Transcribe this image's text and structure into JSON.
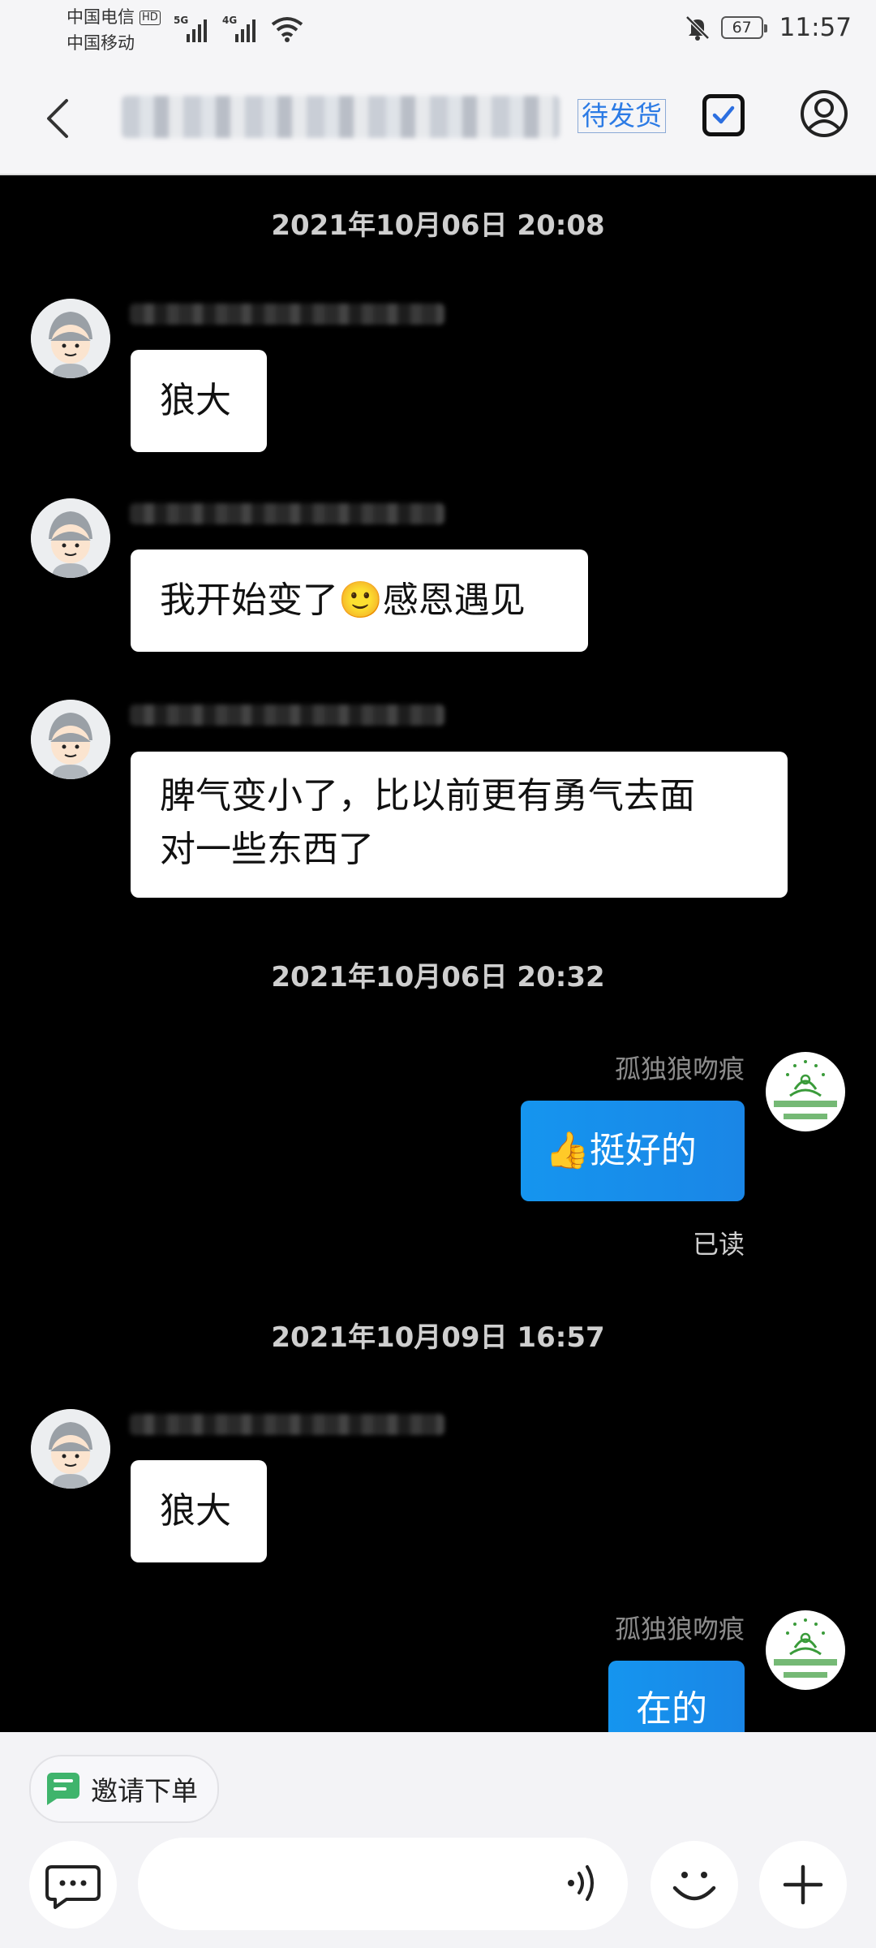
{
  "status_bar": {
    "carrier1": "中国电信",
    "carrier1_badge": "HD",
    "carrier2": "中国移动",
    "network1": "5G",
    "network2": "4G",
    "battery": "67",
    "time": "11:57"
  },
  "header": {
    "contact_name_blurred": "t_1504f3f54f32486_8788",
    "status_label": "待发货"
  },
  "chat": {
    "messages": [
      {
        "timestamp": "2021年10月06日 20:08"
      },
      {
        "sender": "t_1504f3f54f32486_8788",
        "text": "狼大"
      },
      {
        "sender": "t_1504f3f54f32486_8788",
        "text": "我开始变了🙂感恩遇见"
      },
      {
        "sender": "t_1504f3f54f32486_8788",
        "text_line1": "脾气变小了，比以前更有勇气去面",
        "text_line2": "对一些东西了"
      },
      {
        "timestamp": "2021年10月06日 20:32"
      },
      {
        "sender": "孤独狼吻痕",
        "text": "👍挺好的",
        "status": "已读"
      },
      {
        "timestamp": "2021年10月09日 16:57"
      },
      {
        "sender": "t_1504f3f54f32486_8788",
        "text": "狼大"
      },
      {
        "sender": "孤独狼吻痕",
        "text": "在的"
      }
    ]
  },
  "bottom_bar": {
    "invite_label": "邀请下单",
    "input_placeholder": ""
  },
  "icons": {
    "back": "back-arrow-icon",
    "check": "checkbox-icon",
    "profile": "person-icon",
    "chat": "message-icon",
    "voice": "voice-icon",
    "emoji": "emoji-icon",
    "plus": "plus-icon"
  }
}
